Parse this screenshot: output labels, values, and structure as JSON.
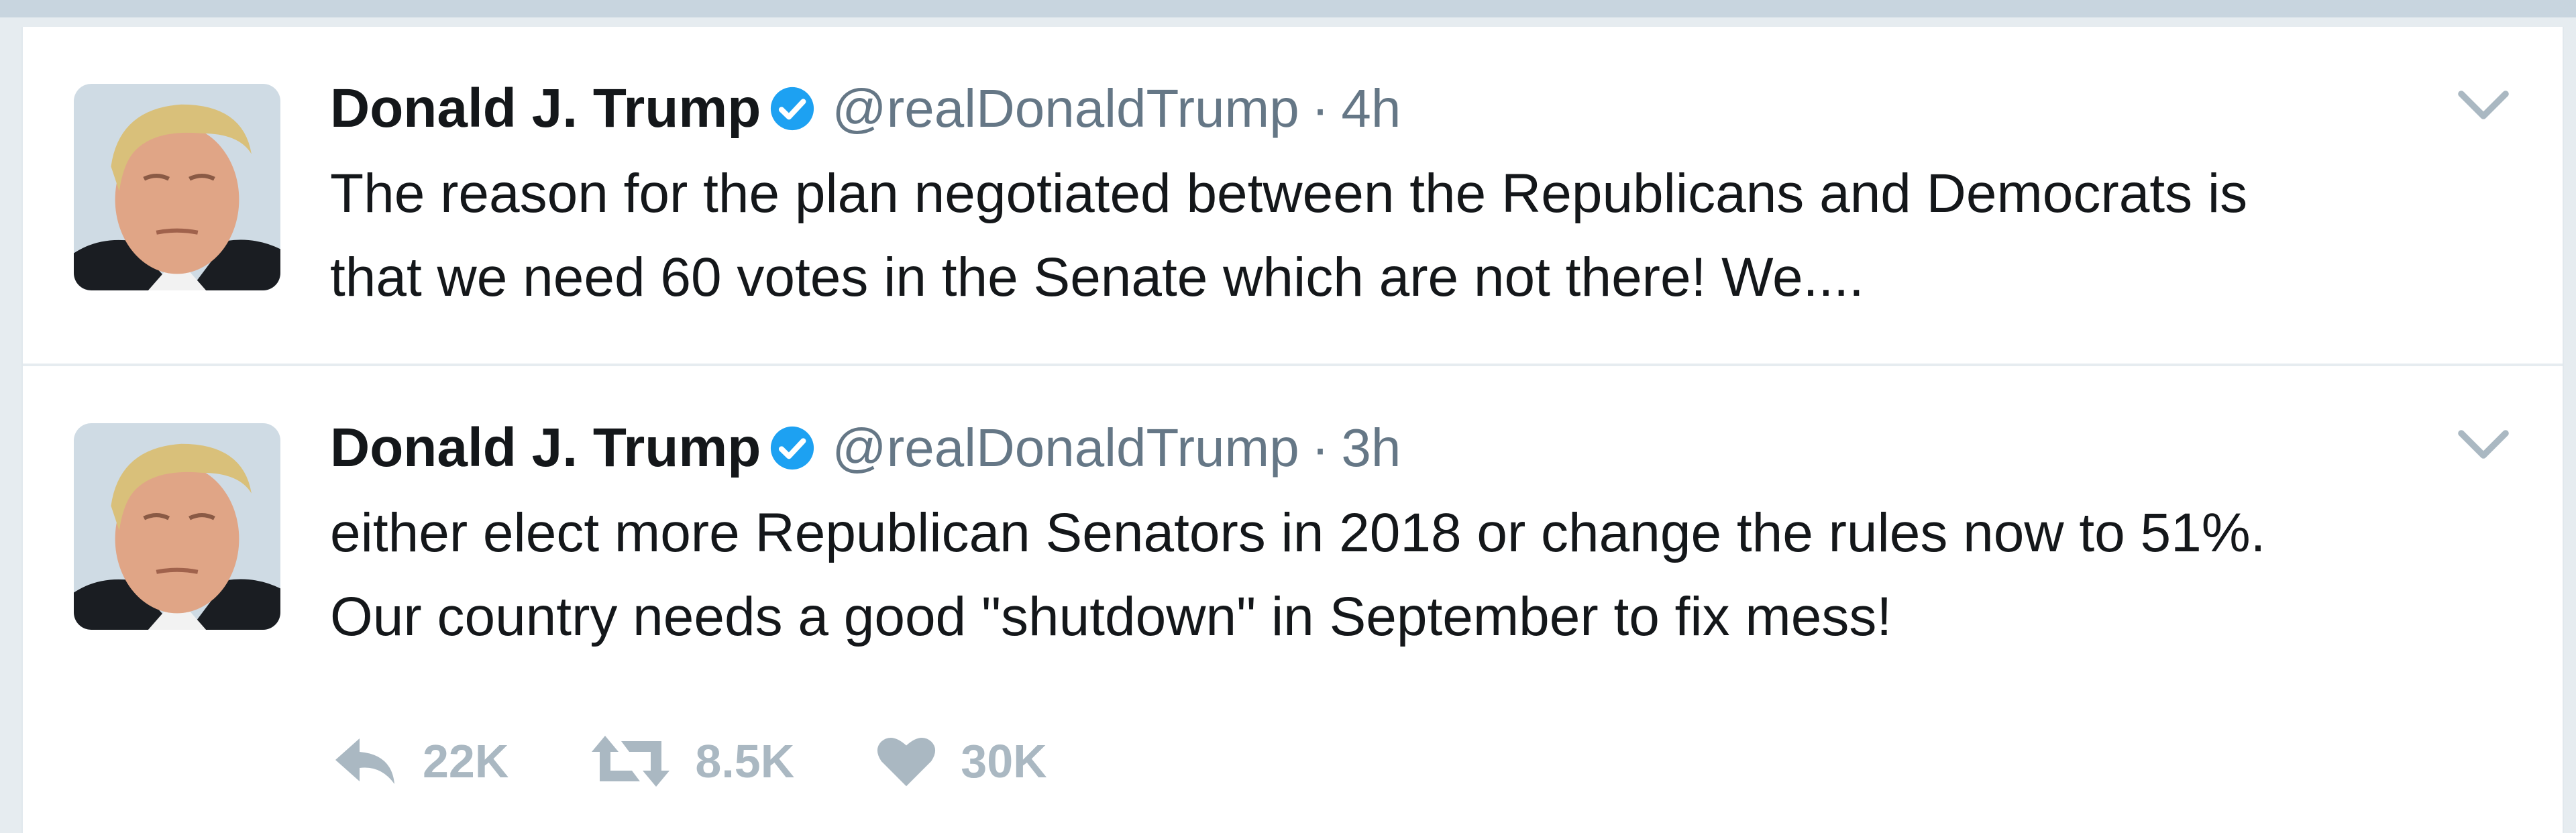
{
  "tweets": [
    {
      "author": "Donald J. Trump",
      "handle": "@realDonaldTrump",
      "separator": "·",
      "time": "4h",
      "text_lines": [
        "The reason for the plan negotiated between the Republicans and Democrats is",
        "that we need 60 votes in the Senate which are not there! We...."
      ]
    },
    {
      "author": "Donald J. Trump",
      "handle": "@realDonaldTrump",
      "separator": "·",
      "time": "3h",
      "text_lines": [
        "either elect more Republican Senators in 2018 or change the rules now to 51%.",
        "Our country needs a good \"shutdown\" in September to fix mess!"
      ],
      "actions": {
        "reply_count": "22K",
        "retweet_count": "8.5K",
        "like_count": "30K"
      }
    }
  ],
  "colors": {
    "verified_badge": "#1da1f2",
    "handle_gray": "#657786",
    "action_gray": "#aab8c2",
    "text": "#14171a"
  }
}
